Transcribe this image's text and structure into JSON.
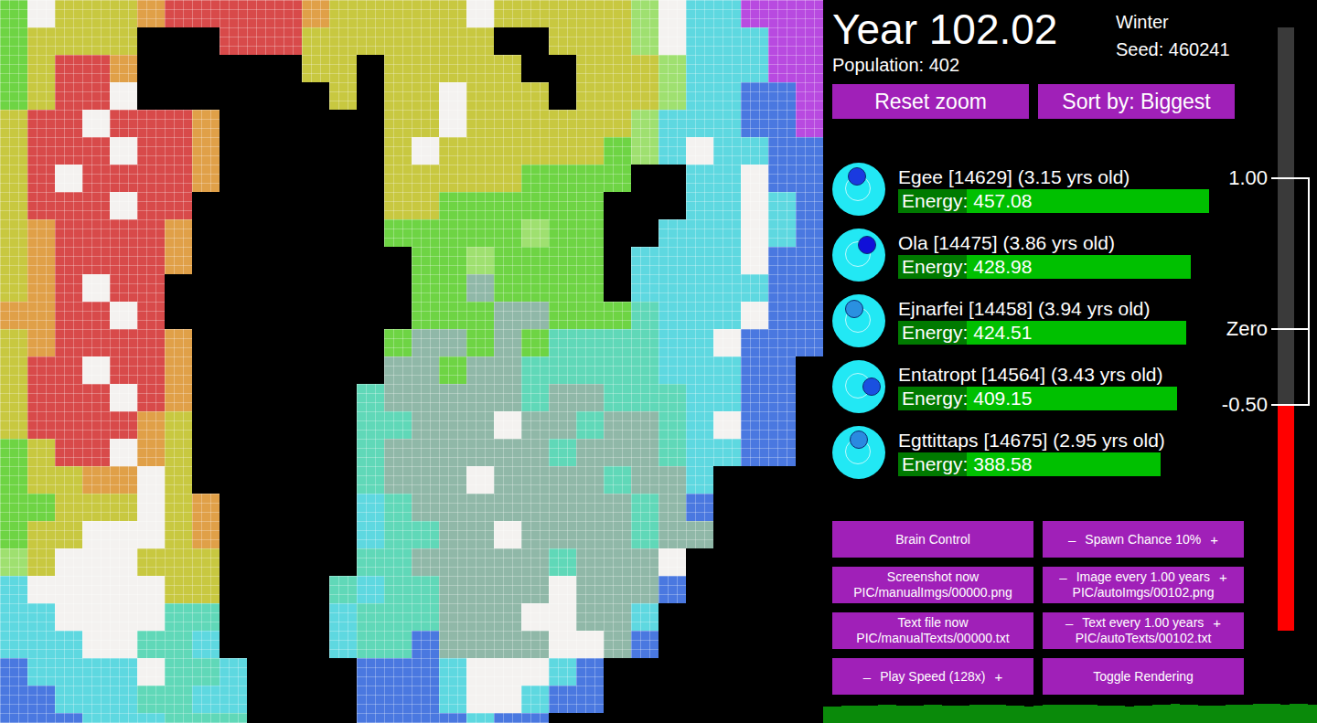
{
  "map": {
    "legend": {
      ".": "#000000",
      "g": "#6ed444",
      "y": "#c8c840",
      "o": "#e0a048",
      "r": "#d84a4a",
      "w": "#f4f2f0",
      "l": "#9fe070",
      "c": "#5ed8e0",
      "b": "#4a78e0",
      "p": "#b84ae0",
      "s": "#90b8a8",
      "t": "#60d8b8"
    },
    "rows": [
      "gwyyyorrrrroyyyyywyyyyylwccppp",
      "gyyyy...rrryyyyyyy..yyylwcccpp",
      "gyrro......yy.yyyyy..yyylcccpp",
      "gyrrw.......y.yywyyy.yyylccbbp",
      "yrrwrrro......yywyyyyyylcccbbp",
      "yrrrwrro......ywyyyyyyglcwccbb",
      "yrwrrrro......yyyyygggg..ccwbb",
      "yrrrwrr.......yygggggg...ccwcb",
      "yorrrro.......ggggglgg..cccwcb",
      "yorrrro........gglgggg.ccccwbb",
      "yorwrr.........ggsgggg.cccccbb",
      "oorrwr.........gggssgggtcccwbb",
      "yorrrro.......gssgsgttttccwbbb",
      "yrrwrro.......ssgsstttttcccbb.",
      "yrrrwro......tssssstsstttccbb.",
      "yrrrroy......ttssswsstsstcwbb.",
      "gyrrwoy......tsssssstssstccbb.",
      "gyyoowy......tssswsssstssc....",
      "ggyyywyo.....ctsssssssstsb....",
      "gyywwwyo.....cttsswsssstss....",
      "lywwwyyy.....ttssssstsssw.....",
      "cwwwwwyy....tcttsssswsssb.....",
      "ccwwwwtt....ctttssswwssc......",
      "cccwwttc....cttbsssswwsb......",
      "bccccwttc....bbbcwwwcb........",
      "bbcccttcc....bbbcwwcbb........",
      "bbbcccttt....bbbbcbb.........."
    ]
  },
  "header": {
    "year": "Year 102.02",
    "season": "Winter",
    "seed": "Seed: 460241",
    "population": "Population: 402"
  },
  "top_buttons": [
    "Reset zoom",
    "Sort by: Biggest"
  ],
  "creatures": [
    {
      "name": "Egee [14629] (3.15 yrs old)",
      "energy": "Energy: 457.08",
      "level": 0.944,
      "heading": 100,
      "eye_color": "#1a3ae0"
    },
    {
      "name": "Ola [14475] (3.86 yrs old)",
      "energy": "Energy: 428.98",
      "level": 0.889,
      "heading": 50,
      "eye_color": "#1010d8"
    },
    {
      "name": "Ejnarfei [14458] (3.94 yrs old)",
      "energy": "Energy: 424.51",
      "level": 0.875,
      "heading": 110,
      "eye_color": "#2a90e0"
    },
    {
      "name": "Entatropt [14564] (3.43 yrs old)",
      "energy": "Energy: 409.15",
      "level": 0.847,
      "heading": 0,
      "eye_color": "#1a50e0"
    },
    {
      "name": "Egttittaps [14675] (2.95 yrs old)",
      "energy": "Energy: 388.58",
      "level": 0.797,
      "heading": 90,
      "eye_color": "#2a8ae0"
    }
  ],
  "controls": [
    {
      "kind": "button",
      "label": "Brain Control",
      "sub": ""
    },
    {
      "kind": "stepper",
      "minus": "–",
      "label": "Spawn Chance 10%",
      "plus": "+",
      "sub": ""
    },
    {
      "kind": "button",
      "label": "Screenshot now",
      "sub": "PIC/manualImgs/00000.png"
    },
    {
      "kind": "stepper",
      "minus": "–",
      "label": "Image every 1.00 years",
      "plus": "+",
      "sub": "PIC/autoImgs/00102.png"
    },
    {
      "kind": "button",
      "label": "Text file now",
      "sub": "PIC/manualTexts/00000.txt"
    },
    {
      "kind": "stepper",
      "minus": "–",
      "label": "Text every 1.00 years",
      "plus": "+",
      "sub": "PIC/autoTexts/00102.txt"
    },
    {
      "kind": "stepper",
      "minus": "–",
      "label": "Play Speed (128x)",
      "plus": "+",
      "sub": ""
    },
    {
      "kind": "button",
      "label": "Toggle Rendering",
      "sub": ""
    }
  ],
  "gauge": {
    "min": -2,
    "max": 2,
    "level": 0.375,
    "ticks": [
      {
        "label": "1.00",
        "value": 1
      },
      {
        "label": "Zero",
        "value": 0
      },
      {
        "label": "-0.50",
        "value": -0.5
      }
    ]
  },
  "population_graph": {
    "values": [
      352,
      360,
      371,
      365,
      380,
      376,
      390,
      384,
      372,
      368,
      381,
      395,
      388,
      379,
      366,
      374,
      385,
      392,
      398,
      387,
      377,
      369,
      362,
      371,
      383,
      391,
      396,
      402,
      394,
      385,
      378,
      370,
      364,
      359,
      368,
      377,
      389,
      397,
      405,
      399,
      390,
      382,
      375,
      381,
      388,
      394,
      400,
      408,
      412,
      406,
      398,
      404,
      410,
      402
    ]
  }
}
